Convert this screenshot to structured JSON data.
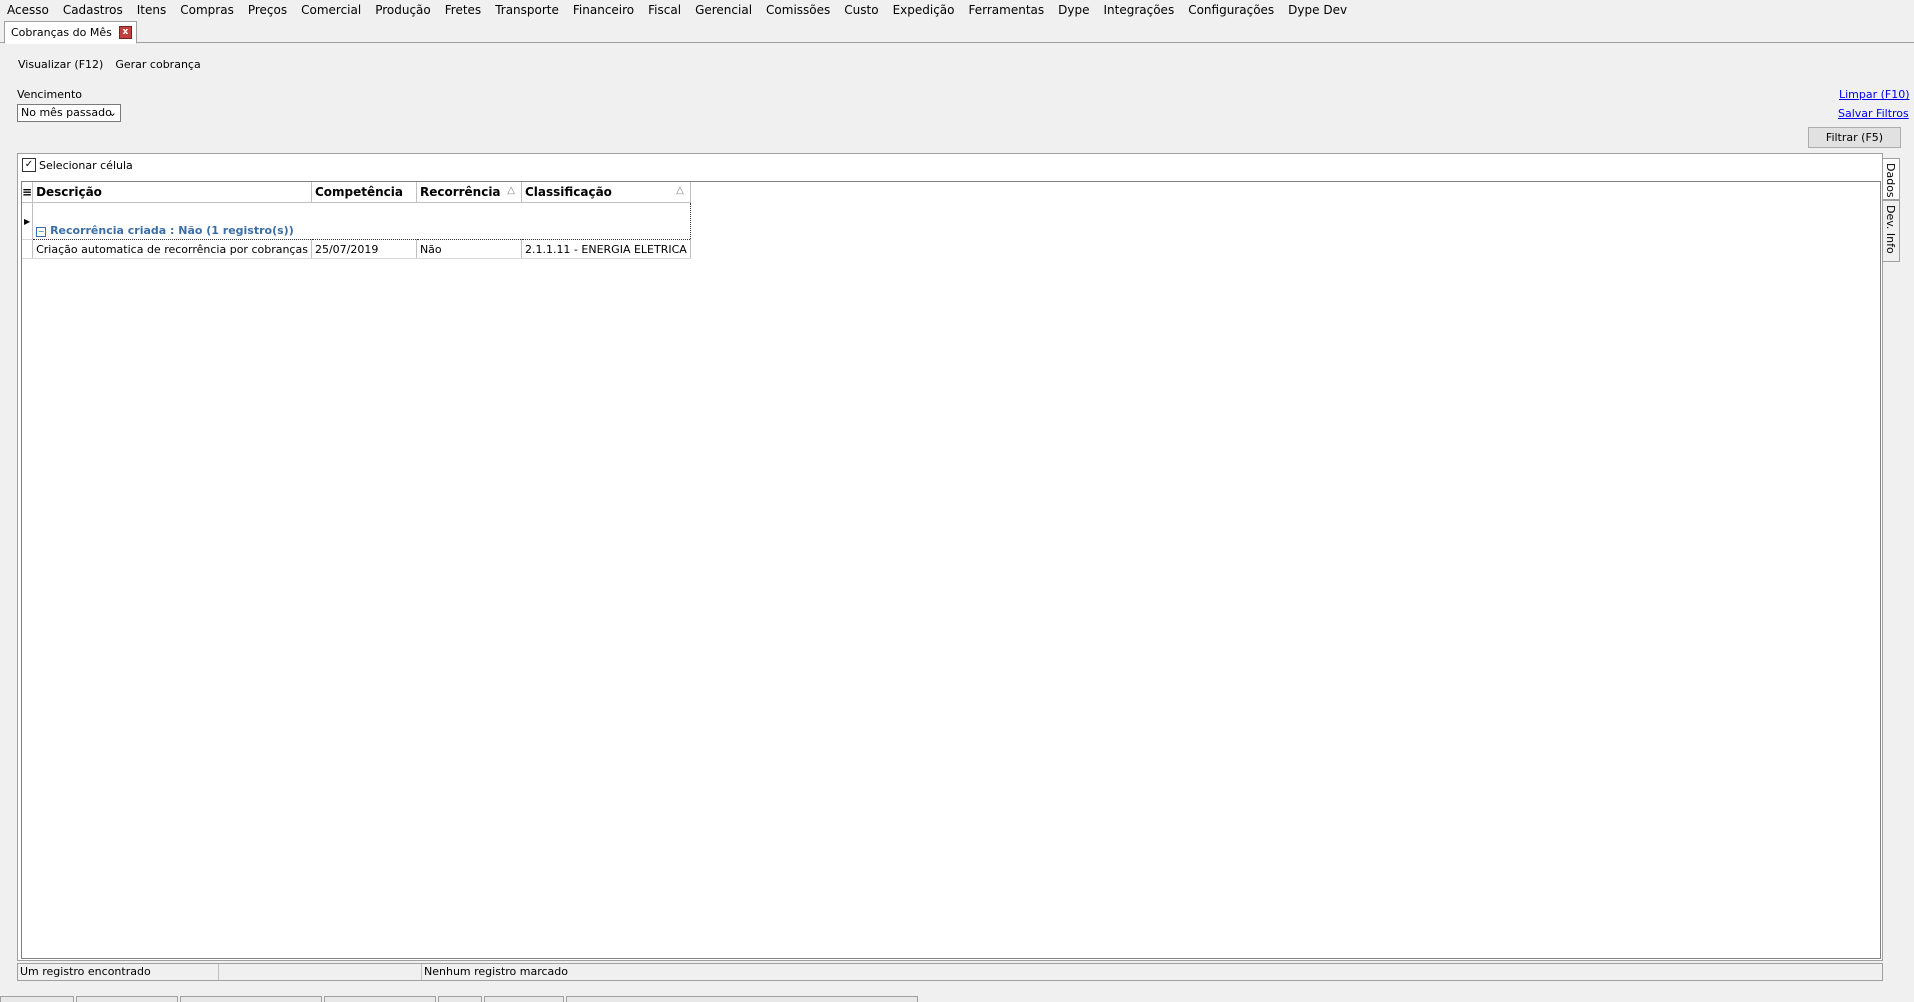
{
  "menu": [
    "Acesso",
    "Cadastros",
    "Itens",
    "Compras",
    "Preços",
    "Comercial",
    "Produção",
    "Fretes",
    "Transporte",
    "Financeiro",
    "Fiscal",
    "Gerencial",
    "Comissões",
    "Custo",
    "Expedição",
    "Ferramentas",
    "Dype",
    "Integrações",
    "Configurações",
    "Dype Dev"
  ],
  "doc_tab": {
    "title": "Cobranças do Mês",
    "close": "x"
  },
  "toolbar": {
    "visualizar": "Visualizar (F12)",
    "gerar": "Gerar cobrança"
  },
  "filters": {
    "vencimento_label": "Vencimento",
    "vencimento_value": "No mês passado",
    "limpar": "Limpar (F10)",
    "salvar": "Salvar Filtros",
    "filtrar": "Filtrar (F5)"
  },
  "grid": {
    "select_cell_label": "Selecionar célula",
    "select_cell_checked": true,
    "columns": [
      "Descrição",
      "Competência",
      "Recorrência",
      "Classificação"
    ],
    "group_label": "Recorrência criada : Não (1 registro(s))",
    "rows": [
      [
        "Criação automatica de recorrência por cobranças",
        "25/07/2019",
        "Não",
        "2.1.1.11 - ENERGIA ELETRICA"
      ]
    ]
  },
  "side_tabs": [
    "Dados",
    "Dev. Info"
  ],
  "status": {
    "left": "Um registro encontrado",
    "right": "Nenhum registro marcado"
  }
}
